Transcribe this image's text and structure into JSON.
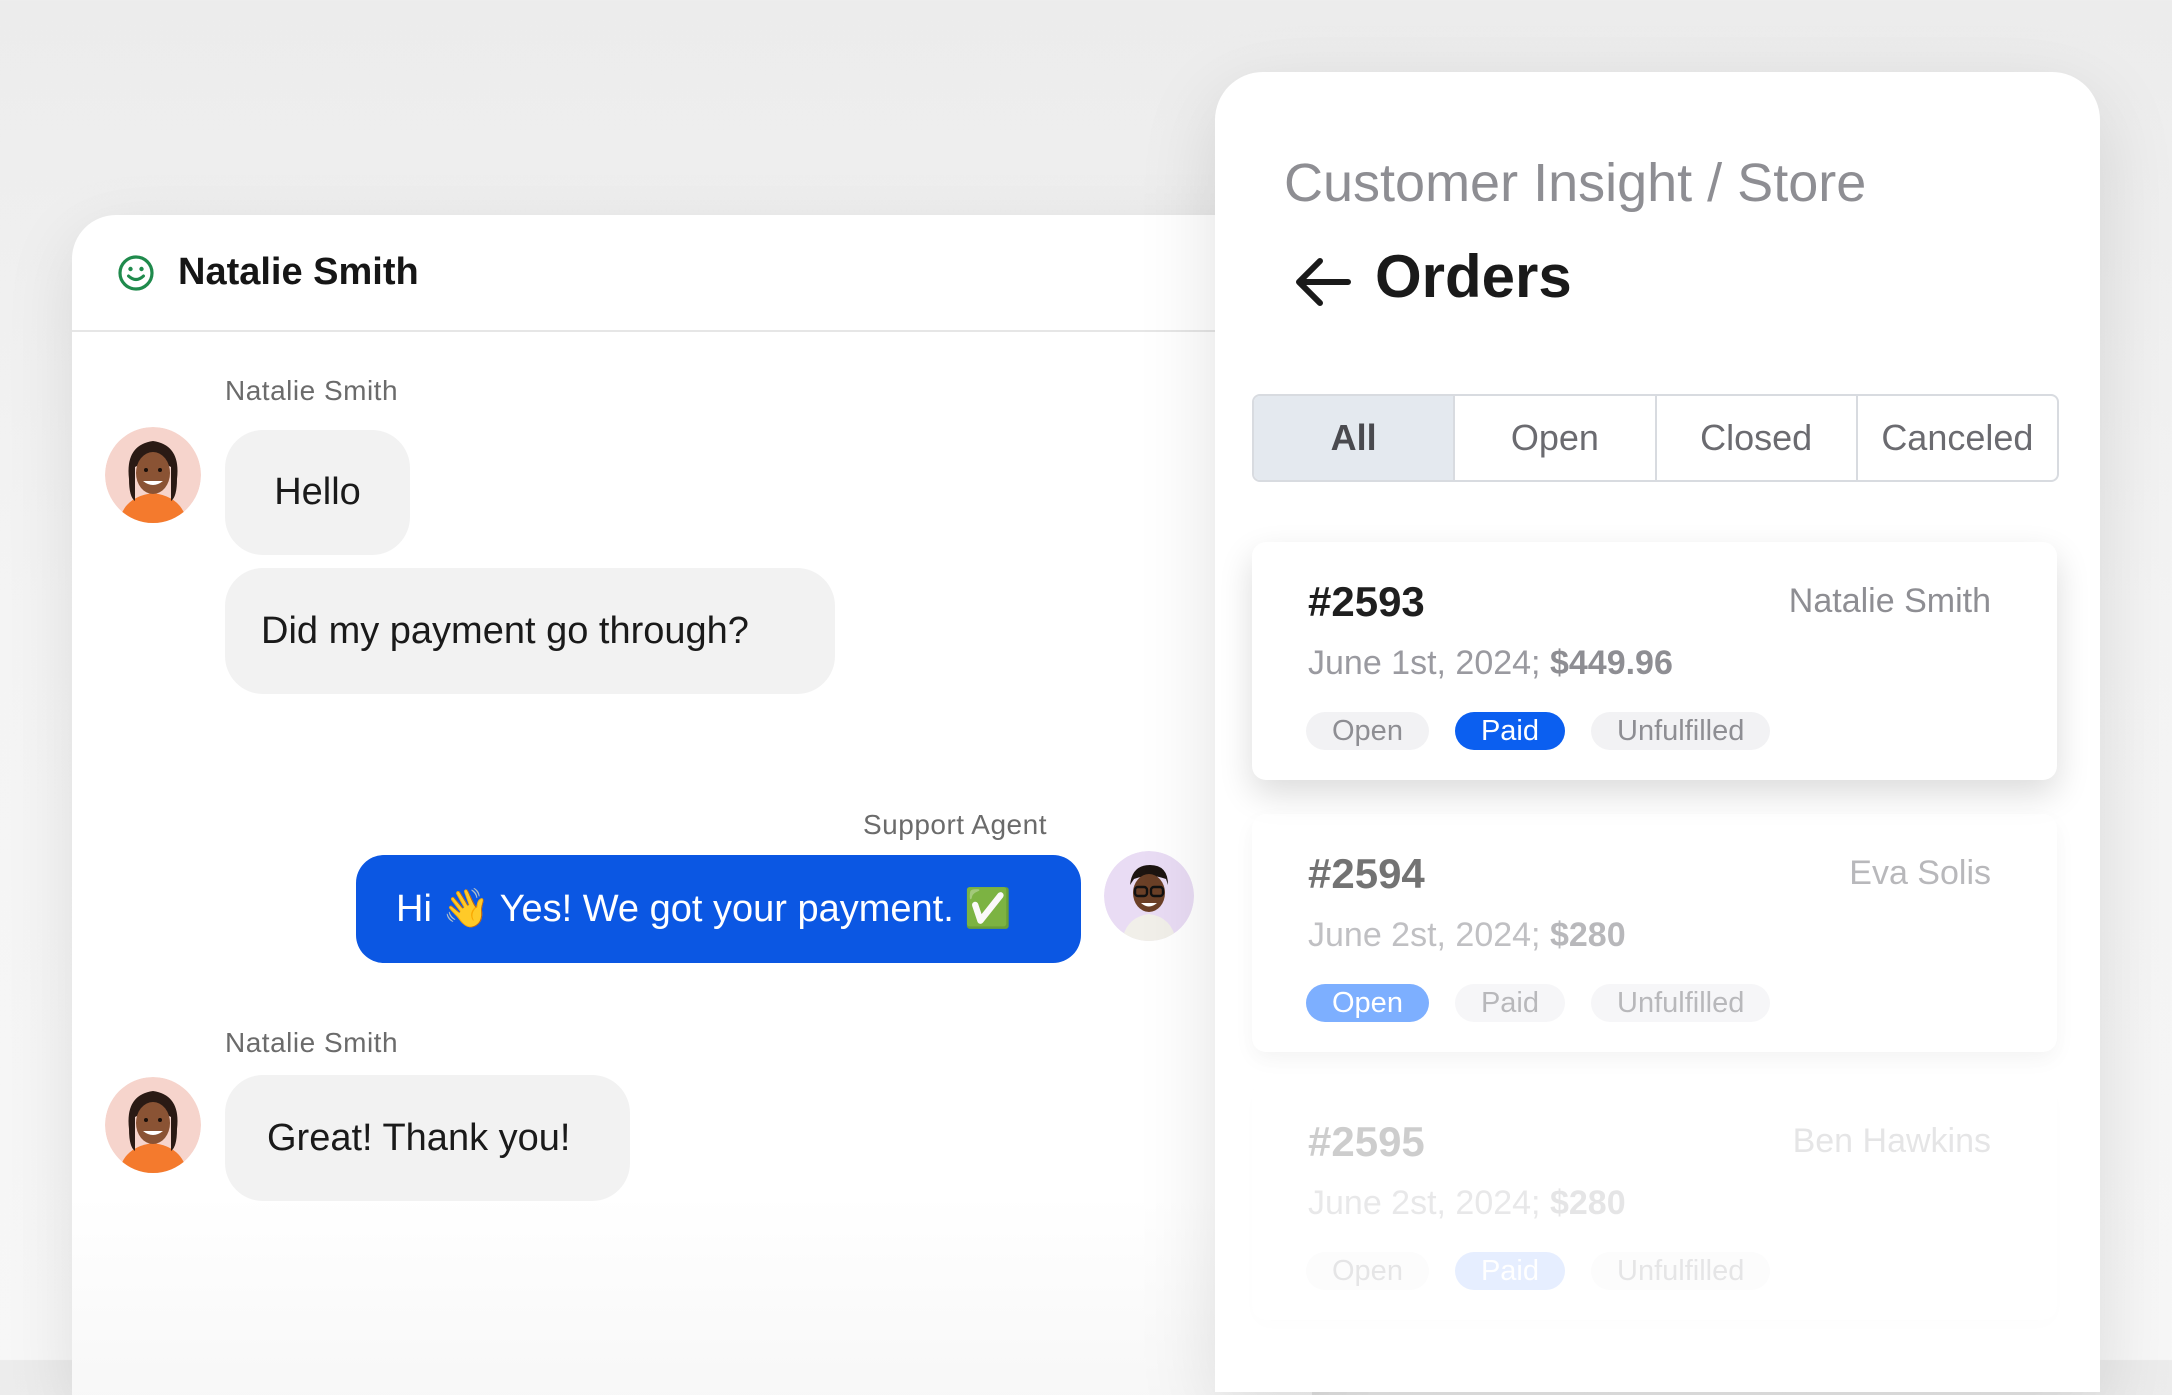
{
  "chat": {
    "header_name": "Natalie Smith",
    "messages": [
      {
        "sender": "Natalie Smith",
        "texts": [
          "Hello",
          "Did my payment go through?"
        ]
      },
      {
        "sender": "Support Agent",
        "text": "Hi 👋 Yes! We got your payment. ✅"
      },
      {
        "sender": "Natalie Smith",
        "text": "Great! Thank you!"
      }
    ]
  },
  "orders": {
    "breadcrumb": "Customer Insight / Store",
    "title": "Orders",
    "tabs": [
      "All",
      "Open",
      "Closed",
      "Canceled"
    ],
    "active_tab": "All",
    "cards": [
      {
        "id": "#2593",
        "customer": "Natalie Smith",
        "date": "June 1st, 2024;",
        "amount": "$449.96",
        "badges": [
          "Open",
          "Paid",
          "Unfulfilled"
        ],
        "highlighted_badge": "Paid"
      },
      {
        "id": "#2594",
        "customer": "Eva Solis",
        "date": "June 2st, 2024;",
        "amount": "$280",
        "badges": [
          "Open",
          "Paid",
          "Unfulfilled"
        ],
        "highlighted_badge": "Open"
      },
      {
        "id": "#2595",
        "customer": "Ben Hawkins",
        "date": "June 2st, 2024;",
        "amount": "$280",
        "badges": [
          "Open",
          "Paid",
          "Unfulfilled"
        ],
        "highlighted_badge": "Paid"
      }
    ]
  },
  "colors": {
    "agent_bubble": "#0b57e3",
    "paid_badge": "#0b5ff0",
    "status_green": "#1f8a4c"
  },
  "icons": {
    "status": "smile-icon",
    "back": "arrow-left-icon"
  }
}
